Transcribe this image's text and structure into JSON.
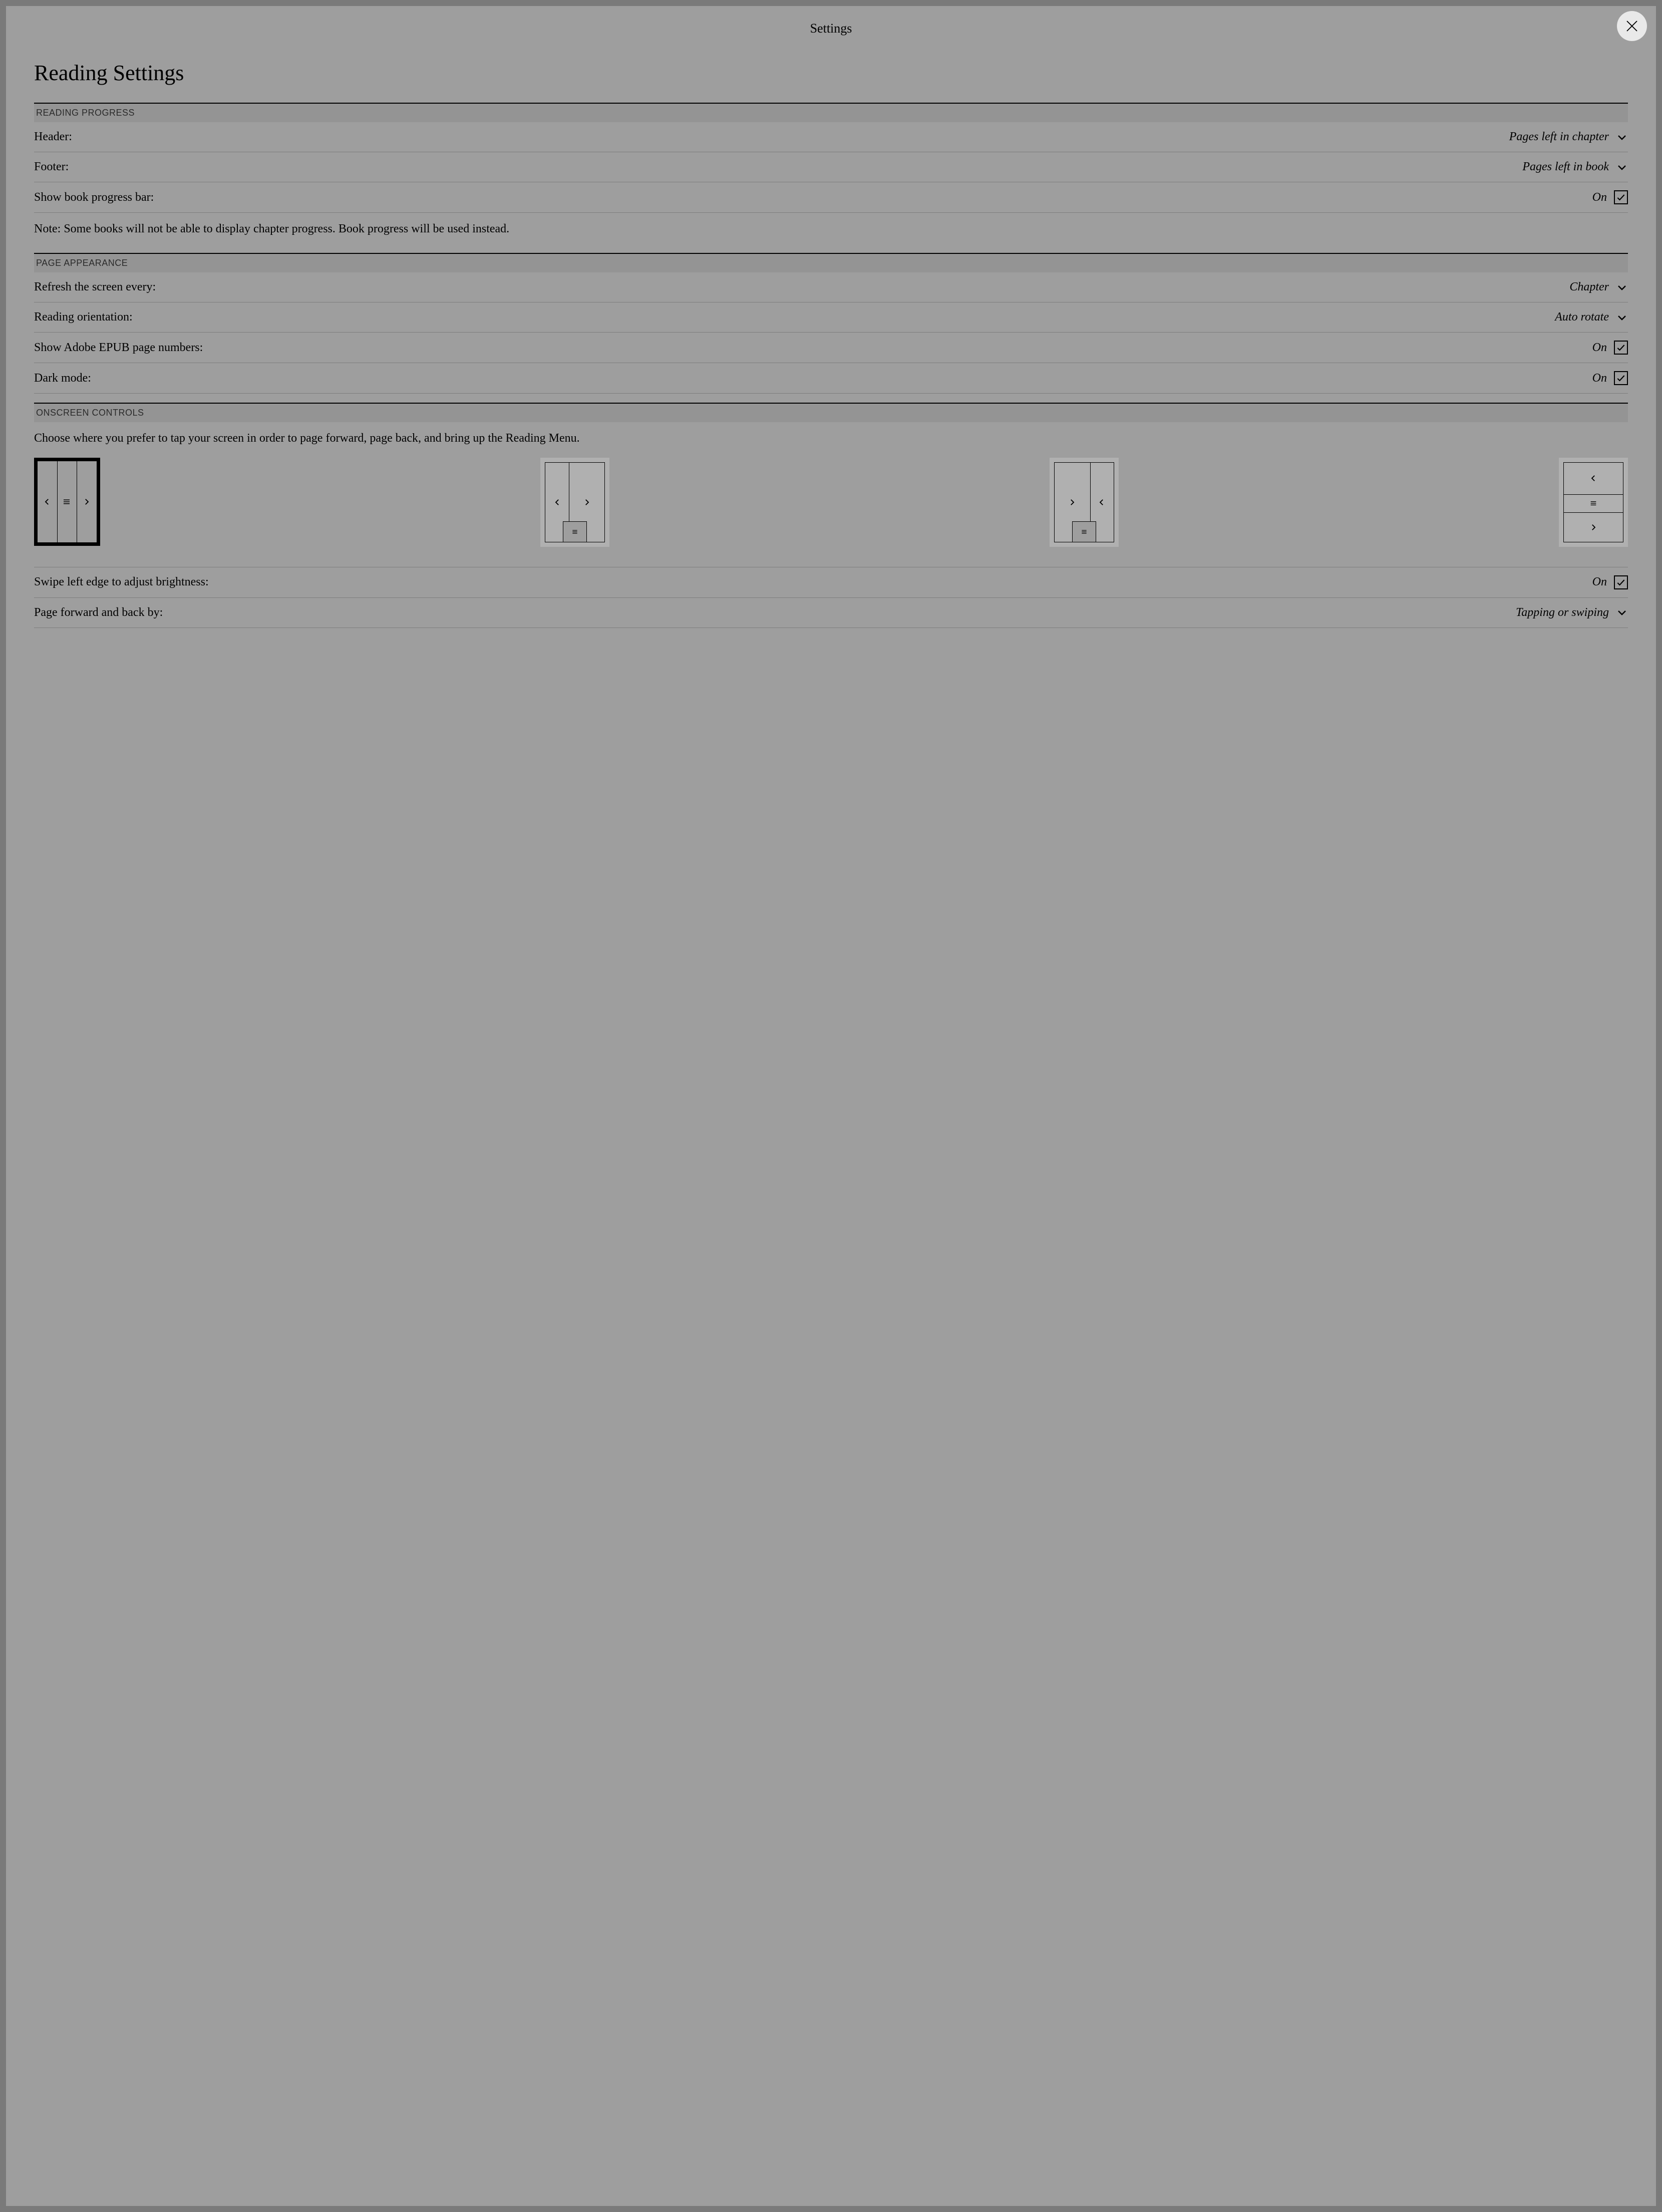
{
  "topbar": {
    "title": "Settings"
  },
  "page": {
    "title": "Reading Settings"
  },
  "sections": {
    "reading_progress": {
      "header": "READING PROGRESS",
      "header_row": {
        "label": "Header:",
        "value": "Pages left in chapter"
      },
      "footer_row": {
        "label": "Footer:",
        "value": "Pages left in book"
      },
      "progress_bar": {
        "label": "Show book progress bar:",
        "value": "On"
      },
      "note": "Note: Some books will not be able to display chapter progress. Book progress will be used instead."
    },
    "page_appearance": {
      "header": "PAGE APPEARANCE",
      "refresh": {
        "label": "Refresh the screen every:",
        "value": "Chapter"
      },
      "orientation": {
        "label": "Reading orientation:",
        "value": "Auto rotate"
      },
      "epub_pages": {
        "label": "Show Adobe EPUB page numbers:",
        "value": "On"
      },
      "dark_mode": {
        "label": "Dark mode:",
        "value": "On"
      }
    },
    "onscreen_controls": {
      "header": "ONSCREEN CONTROLS",
      "description": "Choose where you prefer to tap your screen in order to page forward, page back, and bring up the Reading Menu.",
      "swipe_brightness": {
        "label": "Swipe left edge to adjust brightness:",
        "value": "On"
      },
      "page_turn": {
        "label": "Page forward and back by:",
        "value": "Tapping or swiping"
      }
    }
  }
}
